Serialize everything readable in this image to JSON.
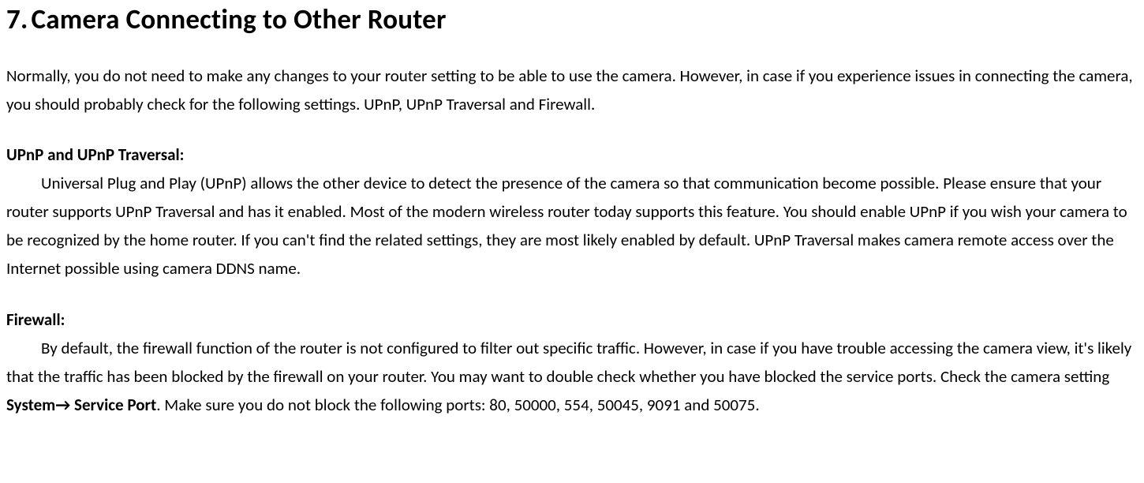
{
  "heading": {
    "number": "7.",
    "title": "Camera Connecting to Other Router"
  },
  "intro": "Normally, you do not need to make any changes to your router setting to be able to use the camera. However, in case if you experience issues in connecting the camera, you should probably check for the following settings. UPnP, UPnP Traversal and Firewall.",
  "upnp": {
    "label": "UPnP and UPnP Traversal:",
    "text": "Universal Plug and Play (UPnP) allows the other device to detect the presence of the camera so that communication become possible. Please ensure that your router supports UPnP Traversal and has it enabled. Most of the modern wireless router today supports this feature. You should enable UPnP if you wish your camera to be recognized by the home router. If you can't find the related settings, they are most likely enabled by default. UPnP Traversal makes camera remote access over the Internet possible using camera DDNS name."
  },
  "firewall": {
    "label": "Firewall:",
    "pre": "By default, the firewall function of the router is not configured to filter out specific traffic. However, in case if you have trouble accessing the camera view, it's likely that the traffic has been blocked by the firewall on your router. You may want to double check whether you have blocked the service ports. Check the camera setting ",
    "path1": "System",
    "arrow": "→",
    "path2": " Service Port",
    "post": ". Make sure you do not block the following ports: 80, 50000, 554, 50045, 9091 and 50075."
  }
}
